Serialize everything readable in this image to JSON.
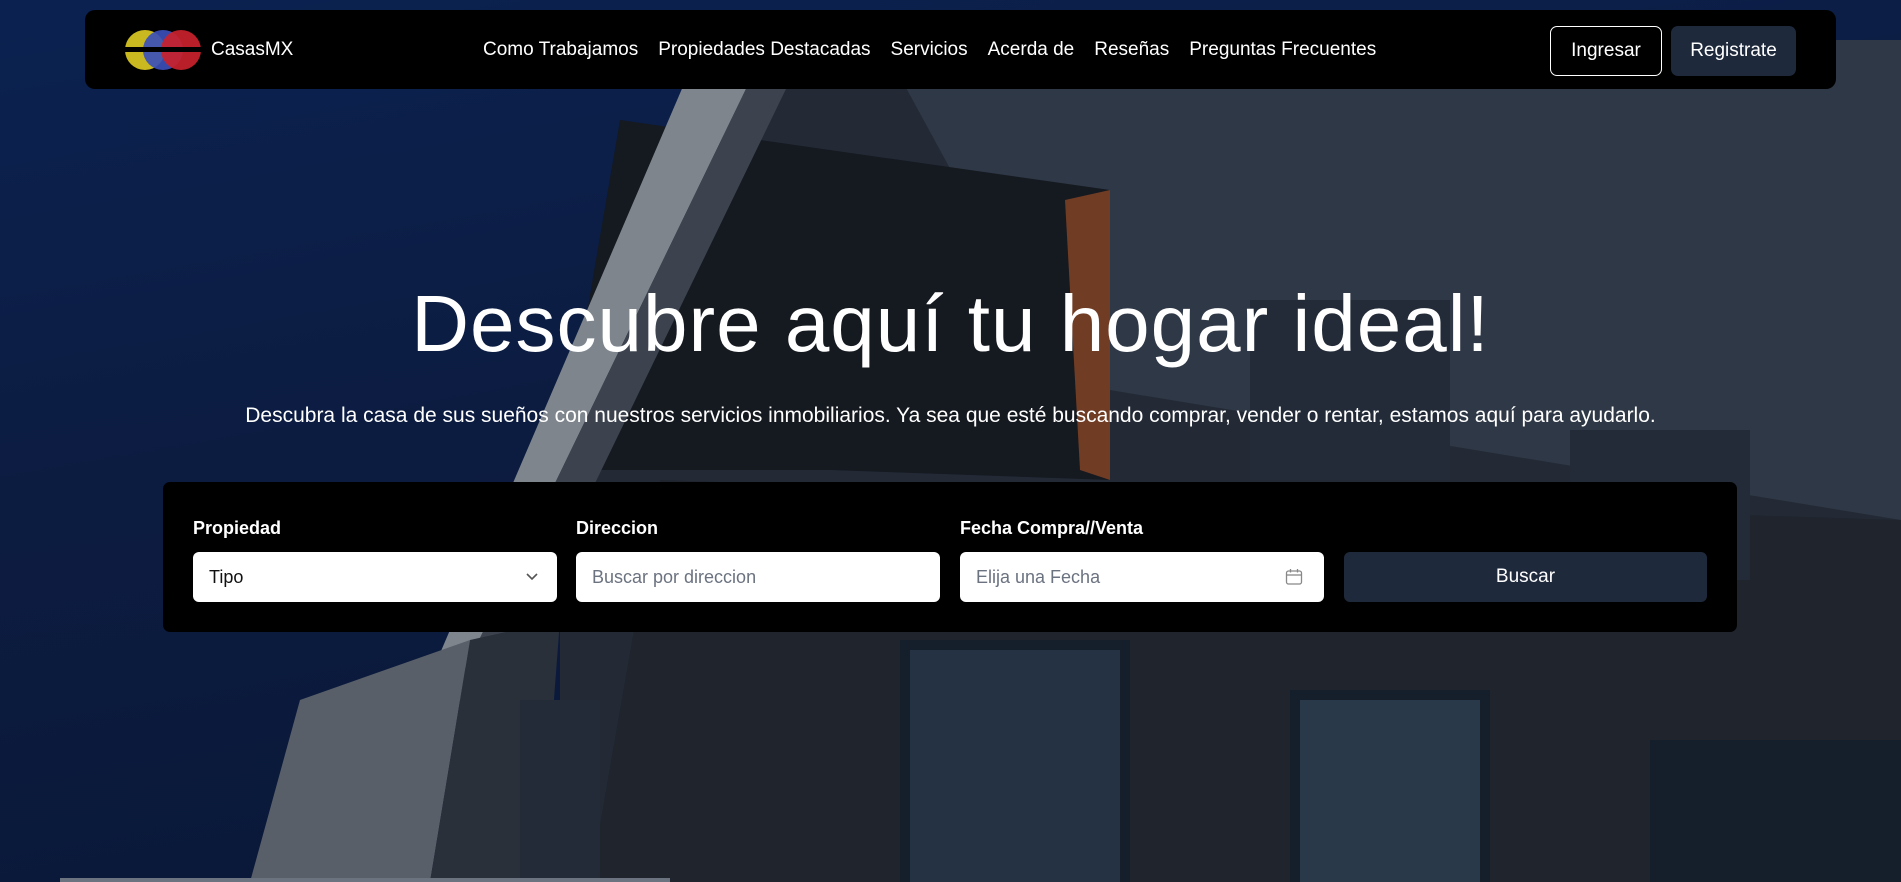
{
  "brand": {
    "name": "CasasMX"
  },
  "nav": {
    "links": [
      {
        "label": "Como Trabajamos"
      },
      {
        "label": "Propiedades Destacadas"
      },
      {
        "label": "Servicios"
      },
      {
        "label": "Acerda de"
      },
      {
        "label": "Reseñas"
      },
      {
        "label": "Preguntas Frecuentes"
      }
    ],
    "login_label": "Ingresar",
    "register_label": "Registrate"
  },
  "hero": {
    "title": "Descubre aquí tu hogar ideal!",
    "subtitle": "Descubra la casa de sus sueños con nuestros servicios inmobiliarios. Ya sea que esté buscando comprar, vender o rentar, estamos aquí para ayudarlo."
  },
  "search": {
    "property": {
      "label": "Propiedad",
      "value": "Tipo"
    },
    "address": {
      "label": "Direccion",
      "placeholder": "Buscar por direccion"
    },
    "date": {
      "label": "Fecha Compra//Venta",
      "placeholder": "Elija una Fecha"
    },
    "submit_label": "Buscar"
  },
  "colors": {
    "navbar_bg": "#000000",
    "button_dark": "#1e293b",
    "sky": "#0f2350",
    "logo_yellow": "#c9b820",
    "logo_blue": "#3b4fb8",
    "logo_red": "#c9222b"
  },
  "icons": [
    "logo-circles",
    "chevron-down-icon",
    "calendar-icon"
  ]
}
